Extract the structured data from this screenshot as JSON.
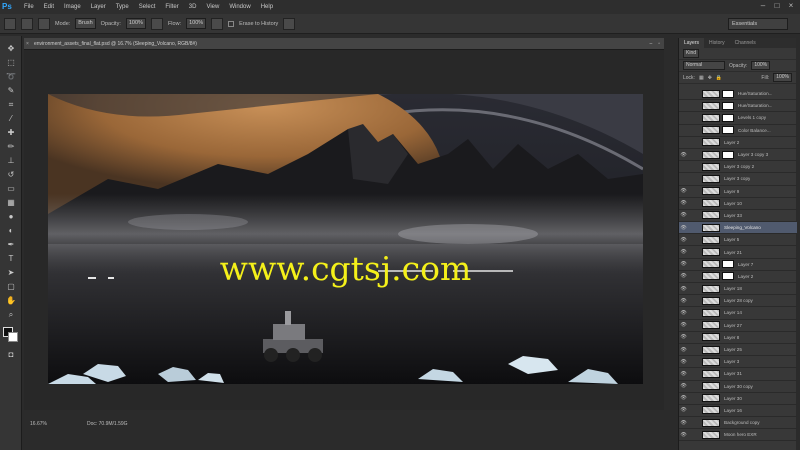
{
  "menubar": {
    "app_logo": "Ps",
    "items": [
      "File",
      "Edit",
      "Image",
      "Layer",
      "Type",
      "Select",
      "Filter",
      "3D",
      "View",
      "Window",
      "Help"
    ]
  },
  "options": {
    "mode_label": "Mode:",
    "mode_value": "Brush",
    "opacity_label": "Opacity:",
    "opacity_value": "100%",
    "flow_label": "Flow:",
    "flow_value": "100%",
    "erase_history_label": "Erase to History",
    "workspace_value": "Essentials"
  },
  "document": {
    "tab_title": "environment_assets_final_flat.psd @ 16.7% (Sleeping_Volcano, RGB/8#)",
    "zoom": "16.67%",
    "doc_info": "Doc: 70.9M/1.59G"
  },
  "watermark": "www.cgtsj.com",
  "panel": {
    "tabs": [
      "Layers",
      "History",
      "Channels"
    ],
    "kind_label": "Kind",
    "blend_mode": "Normal",
    "opacity_label": "Opacity:",
    "opacity_value": "100%",
    "lock_label": "Lock:",
    "fill_label": "Fill:",
    "fill_value": "100%",
    "layers": [
      {
        "name": "Hue/Saturation...",
        "visible": false,
        "mask": true
      },
      {
        "name": "Hue/Saturation...",
        "visible": false,
        "mask": true
      },
      {
        "name": "Levels 1 copy",
        "visible": false,
        "mask": true
      },
      {
        "name": "Color Balance...",
        "visible": false,
        "mask": true
      },
      {
        "name": "Layer 2",
        "visible": false,
        "mask": false
      },
      {
        "name": "Layer 3 copy 3",
        "visible": true,
        "mask": true
      },
      {
        "name": "Layer 3 copy 2",
        "visible": false,
        "mask": false
      },
      {
        "name": "Layer 3 copy",
        "visible": false,
        "mask": false
      },
      {
        "name": "Layer 9",
        "visible": true,
        "mask": false
      },
      {
        "name": "Layer 10",
        "visible": true,
        "mask": false
      },
      {
        "name": "Layer 33",
        "visible": true,
        "mask": false
      },
      {
        "name": "Sleeping_Volcano",
        "visible": true,
        "mask": false,
        "selected": true
      },
      {
        "name": "Layer 5",
        "visible": true,
        "mask": false
      },
      {
        "name": "Layer 21",
        "visible": true,
        "mask": false
      },
      {
        "name": "Layer 7",
        "visible": true,
        "mask": true
      },
      {
        "name": "Layer 2",
        "visible": true,
        "mask": true
      },
      {
        "name": "Layer 18",
        "visible": true,
        "mask": false
      },
      {
        "name": "Layer 28 copy",
        "visible": true,
        "mask": false
      },
      {
        "name": "Layer 14",
        "visible": true,
        "mask": false
      },
      {
        "name": "Layer 27",
        "visible": true,
        "mask": false
      },
      {
        "name": "Layer 8",
        "visible": true,
        "mask": false
      },
      {
        "name": "Layer 25",
        "visible": true,
        "mask": false
      },
      {
        "name": "Layer 3",
        "visible": true,
        "mask": false
      },
      {
        "name": "Layer 31",
        "visible": true,
        "mask": false
      },
      {
        "name": "Layer 30 copy",
        "visible": true,
        "mask": false
      },
      {
        "name": "Layer 30",
        "visible": true,
        "mask": false
      },
      {
        "name": "Layer 16",
        "visible": true,
        "mask": false
      },
      {
        "name": "Background copy",
        "visible": true,
        "mask": false
      },
      {
        "name": "Moon hero EXR",
        "visible": true,
        "mask": false
      }
    ]
  },
  "colors": {
    "app_bg": "#2b2b2b",
    "panel_bg": "#383838",
    "selection": "#505a6e",
    "watermark": "#f4f01a",
    "planet": "#b07a45"
  }
}
